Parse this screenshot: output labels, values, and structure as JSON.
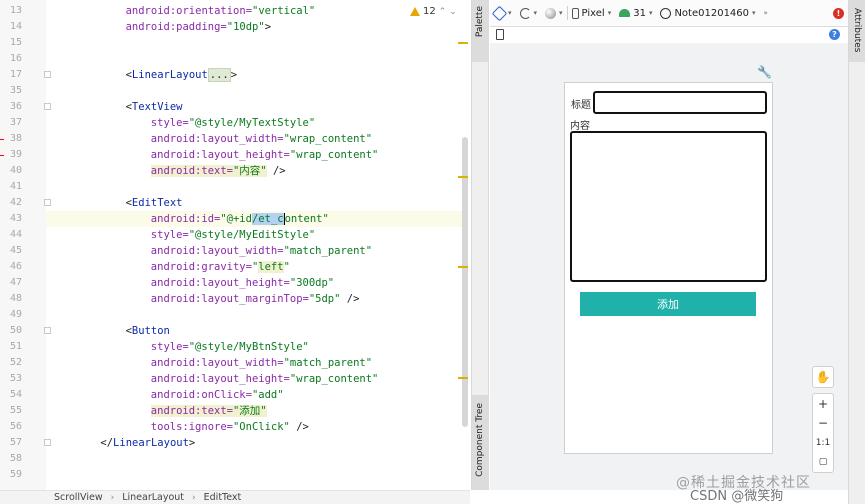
{
  "editor": {
    "lines": [
      {
        "n": "13",
        "segs": [
          {
            "c": "attr",
            "t": "android:orientation="
          },
          {
            "c": "str",
            "t": "\"vertical\""
          }
        ],
        "indent": 12
      },
      {
        "n": "14",
        "segs": [
          {
            "c": "attr",
            "t": "android:padding="
          },
          {
            "c": "str",
            "t": "\"10dp\""
          },
          {
            "c": "",
            "t": ">"
          }
        ],
        "indent": 12
      },
      {
        "n": "15",
        "segs": [],
        "indent": 0
      },
      {
        "n": "16",
        "segs": [],
        "indent": 0
      },
      {
        "n": "17",
        "segs": [
          {
            "c": "",
            "t": "<"
          },
          {
            "c": "tag",
            "t": "LinearLayout"
          },
          {
            "c": "fold",
            "t": "..."
          },
          {
            "c": "",
            "t": ">"
          }
        ],
        "indent": 12
      },
      {
        "n": "35",
        "segs": [],
        "indent": 0
      },
      {
        "n": "36",
        "segs": [
          {
            "c": "",
            "t": "<"
          },
          {
            "c": "tag",
            "t": "TextView"
          }
        ],
        "indent": 12
      },
      {
        "n": "37",
        "segs": [
          {
            "c": "attr",
            "t": "style="
          },
          {
            "c": "str",
            "t": "\"@style/MyTextStyle\""
          }
        ],
        "indent": 16
      },
      {
        "n": "38",
        "segs": [
          {
            "c": "attr",
            "t": "android:layout_width="
          },
          {
            "c": "str",
            "t": "\"wrap_content\""
          }
        ],
        "indent": 16
      },
      {
        "n": "39",
        "segs": [
          {
            "c": "attr",
            "t": "android:layout_height="
          },
          {
            "c": "str",
            "t": "\"wrap_content\""
          }
        ],
        "indent": 16
      },
      {
        "n": "40",
        "segs": [
          {
            "c": "attr hlbox",
            "t": "android:text="
          },
          {
            "c": "str hlbox",
            "t": "\"内容\""
          },
          {
            "c": "",
            "t": " />"
          }
        ],
        "indent": 16
      },
      {
        "n": "41",
        "segs": [],
        "indent": 0
      },
      {
        "n": "42",
        "segs": [
          {
            "c": "",
            "t": "<"
          },
          {
            "c": "tag",
            "t": "EditText"
          }
        ],
        "indent": 12
      },
      {
        "n": "43",
        "segs": [
          {
            "c": "attr",
            "t": "android:id="
          },
          {
            "c": "str",
            "t": "\"@+id"
          },
          {
            "c": "str sel",
            "t": "/et_c"
          },
          {
            "c": "str caret",
            "t": "ontent\""
          }
        ],
        "indent": 16
      },
      {
        "n": "44",
        "segs": [
          {
            "c": "attr",
            "t": "style="
          },
          {
            "c": "str",
            "t": "\"@style/MyEditStyle\""
          }
        ],
        "indent": 16
      },
      {
        "n": "45",
        "segs": [
          {
            "c": "attr",
            "t": "android:layout_width="
          },
          {
            "c": "str",
            "t": "\"match_parent\""
          }
        ],
        "indent": 16
      },
      {
        "n": "46",
        "segs": [
          {
            "c": "attr",
            "t": "android:gravity="
          },
          {
            "c": "str",
            "t": "\""
          },
          {
            "c": "str hlbox",
            "t": "left"
          },
          {
            "c": "str",
            "t": "\""
          }
        ],
        "indent": 16
      },
      {
        "n": "47",
        "segs": [
          {
            "c": "attr",
            "t": "android:layout_height="
          },
          {
            "c": "str",
            "t": "\"300dp\""
          }
        ],
        "indent": 16
      },
      {
        "n": "48",
        "segs": [
          {
            "c": "attr",
            "t": "android:layout_marginTop="
          },
          {
            "c": "str",
            "t": "\"5dp\""
          },
          {
            "c": "",
            "t": " />"
          }
        ],
        "indent": 16
      },
      {
        "n": "49",
        "segs": [],
        "indent": 0
      },
      {
        "n": "50",
        "segs": [
          {
            "c": "",
            "t": "<"
          },
          {
            "c": "tag",
            "t": "Button"
          }
        ],
        "indent": 12
      },
      {
        "n": "51",
        "segs": [
          {
            "c": "attr",
            "t": "style="
          },
          {
            "c": "str",
            "t": "\"@style/MyBtnStyle\""
          }
        ],
        "indent": 16
      },
      {
        "n": "52",
        "segs": [
          {
            "c": "attr",
            "t": "android:layout_width="
          },
          {
            "c": "str",
            "t": "\"match_parent\""
          }
        ],
        "indent": 16
      },
      {
        "n": "53",
        "segs": [
          {
            "c": "attr",
            "t": "android:layout_height="
          },
          {
            "c": "str",
            "t": "\"wrap_content\""
          }
        ],
        "indent": 16
      },
      {
        "n": "54",
        "segs": [
          {
            "c": "attr",
            "t": "android:onClick="
          },
          {
            "c": "str",
            "t": "\"add\""
          }
        ],
        "indent": 16
      },
      {
        "n": "55",
        "segs": [
          {
            "c": "attr hlbox",
            "t": "android:text="
          },
          {
            "c": "str hlbox",
            "t": "\"添加\""
          }
        ],
        "indent": 16
      },
      {
        "n": "56",
        "segs": [
          {
            "c": "attr",
            "t": "tools:ignore="
          },
          {
            "c": "str",
            "t": "\"OnClick\""
          },
          {
            "c": "",
            "t": " />"
          }
        ],
        "indent": 16
      },
      {
        "n": "57",
        "segs": [
          {
            "c": "",
            "t": "</"
          },
          {
            "c": "tag",
            "t": "LinearLayout"
          },
          {
            "c": "",
            "t": ">"
          }
        ],
        "indent": 8
      },
      {
        "n": "58",
        "segs": [],
        "indent": 0
      },
      {
        "n": "59",
        "segs": [],
        "indent": 0
      }
    ],
    "warning_count": "12"
  },
  "breadcrumb": [
    "ScrollView",
    "LinearLayout",
    "EditText"
  ],
  "side_tabs": {
    "palette": "Palette",
    "component_tree": "Component Tree",
    "attributes": "Attributes"
  },
  "design_toolbar": {
    "device": "Pixel",
    "api": "31",
    "theme": "Note01201460"
  },
  "preview": {
    "title_label": "标题",
    "content_label": "内容",
    "add_button": "添加"
  },
  "zoom": {
    "plus": "+",
    "minus": "−",
    "one_to_one": "1:1"
  },
  "watermark": {
    "line1": "@稀土掘金技术社区",
    "line2": "CSDN @微笑狗"
  }
}
